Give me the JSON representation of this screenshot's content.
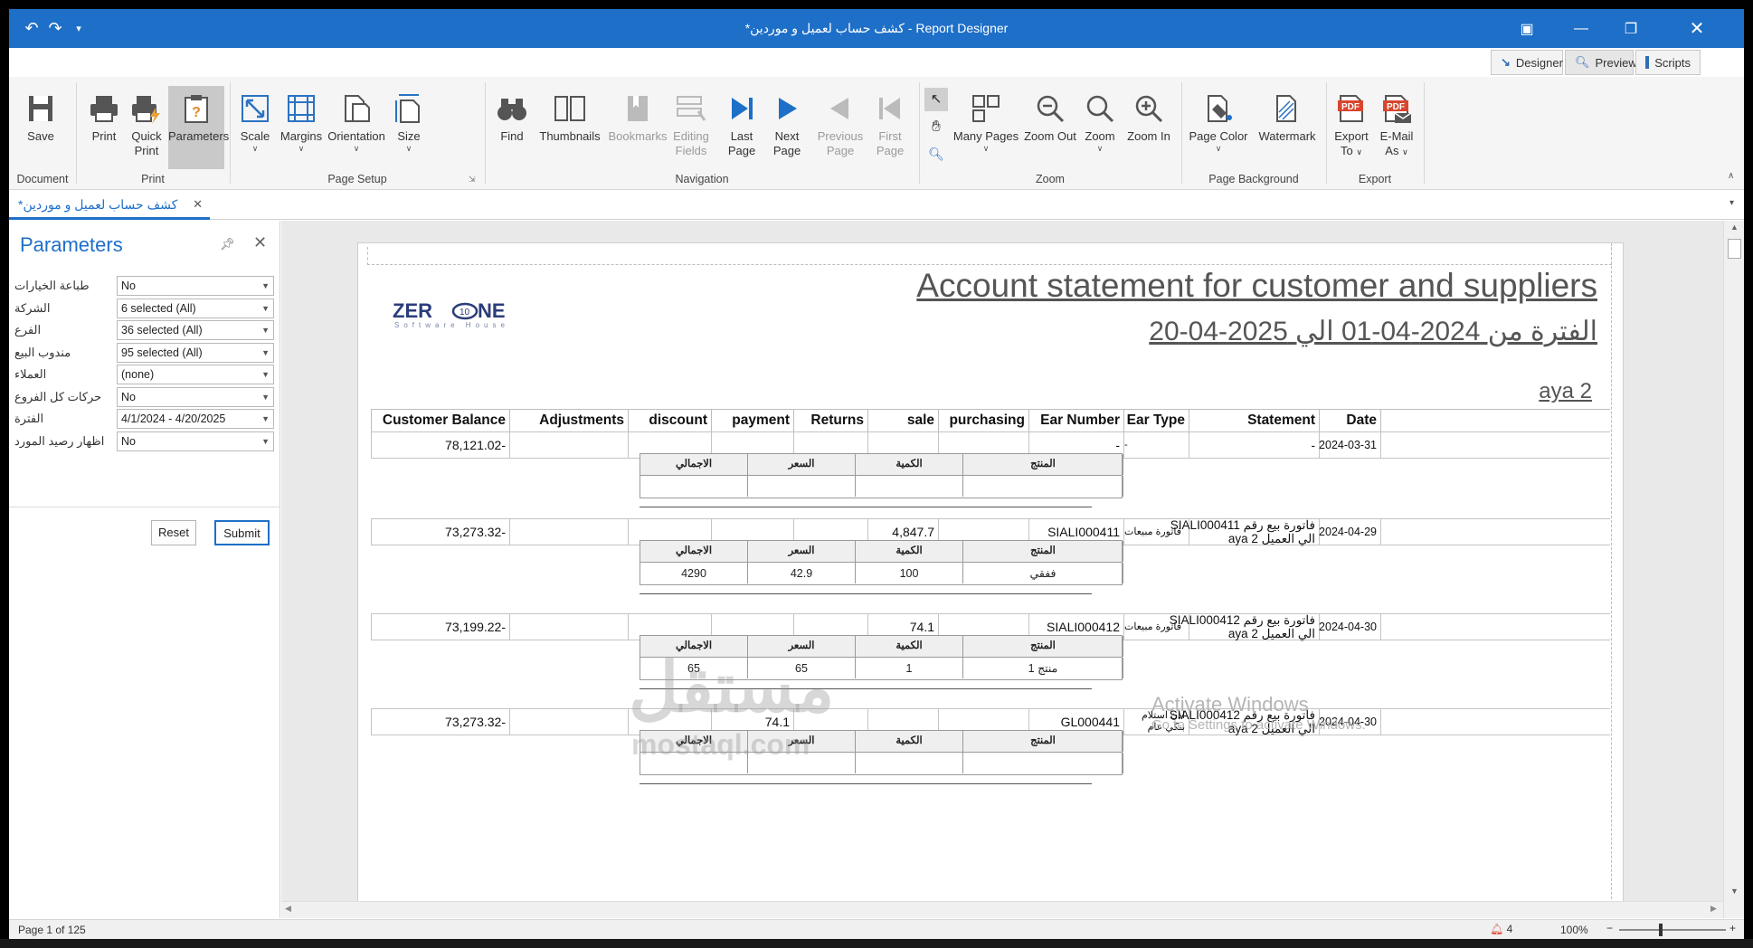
{
  "window": {
    "title": "*كشف حساب لعميل و موردين - Report Designer"
  },
  "views": {
    "designer": "Designer",
    "preview": "Preview",
    "scripts": "Scripts"
  },
  "ribbon": {
    "save": "Save",
    "print": "Print",
    "quick_print_1": "Quick",
    "quick_print_2": "Print",
    "parameters": "Parameters",
    "scale": "Scale",
    "margins": "Margins",
    "orientation": "Orientation",
    "size": "Size",
    "find": "Find",
    "thumbnails": "Thumbnails",
    "bookmarks": "Bookmarks",
    "editing_fields_1": "Editing",
    "editing_fields_2": "Fields",
    "last_page_1": "Last",
    "last_page_2": "Page",
    "next_page_1": "Next",
    "next_page_2": "Page",
    "previous_page_1": "Previous",
    "previous_page_2": "Page",
    "first_page_1": "First",
    "first_page_2": "Page",
    "many_pages": "Many Pages",
    "zoom_out": "Zoom Out",
    "zoom": "Zoom",
    "zoom_in": "Zoom In",
    "page_color": "Page Color",
    "watermark": "Watermark",
    "export_to_1": "Export",
    "export_to_2": "To",
    "email_as_1": "E-Mail",
    "email_as_2": "As",
    "pdf_badge": "PDF",
    "groups": {
      "document": "Document",
      "print": "Print",
      "page_setup": "Page Setup",
      "navigation": "Navigation",
      "zoom": "Zoom",
      "page_background": "Page Background",
      "export": "Export"
    }
  },
  "doc_tab": {
    "label": "*كشف حساب لعميل و موردين"
  },
  "parameters": {
    "title": "Parameters",
    "rows": [
      {
        "label": "طباعة الخيارات",
        "value": "No"
      },
      {
        "label": "الشركة",
        "value": "6 selected (All)"
      },
      {
        "label": "الفرع",
        "value": "36 selected (All)"
      },
      {
        "label": "مندوب البيع",
        "value": "95 selected (All)"
      },
      {
        "label": "العملاء",
        "value": "(none)"
      },
      {
        "label": "حركات كل الفروع",
        "value": "No"
      },
      {
        "label": "الفترة",
        "value": "4/1/2024 - 4/20/2025"
      },
      {
        "label": "اظهار رصيد المورد",
        "value": "No"
      }
    ],
    "reset": "Reset",
    "submit": "Submit"
  },
  "report": {
    "title": "Account statement for customer and suppliers",
    "period": "الفترة من 2024-04-01 الي 2025-04-20",
    "customer": "aya 2",
    "logo_text": "ZER",
    "logo_text2": "NE",
    "logo_sub": "Software House",
    "columns": [
      "Customer Balance",
      "Adjustments",
      "discount",
      "payment",
      "Returns",
      "sale",
      "purchasing",
      "Ear Number",
      "Ear Type",
      "Statement",
      "Date"
    ],
    "sub_columns": [
      "الاجمالي",
      "السعر",
      "الكمية",
      "المنتج"
    ],
    "rows": [
      {
        "balance": "78,121.02-",
        "adjustments": "",
        "discount": "",
        "payment": "",
        "returns": "",
        "sale": "",
        "purchasing": "",
        "ear_number": "-",
        "ear_type": "-",
        "statement_1": "-",
        "statement_2": "",
        "date": "2024-03-31",
        "sub": {
          "total": "",
          "price": "",
          "qty": "",
          "product": ""
        }
      },
      {
        "balance": "73,273.32-",
        "adjustments": "",
        "discount": "",
        "payment": "",
        "returns": "",
        "sale": "4,847.7",
        "purchasing": "",
        "ear_number": "SIALI000411",
        "ear_type": "فاتورة مبيعات",
        "statement_1": "فاتورة بيع رقم SIALI000411",
        "statement_2": "الي العميل  aya 2",
        "date": "2024-04-29",
        "sub": {
          "total": "4290",
          "price": "42.9",
          "qty": "100",
          "product": "ففقي"
        }
      },
      {
        "balance": "73,199.22-",
        "adjustments": "",
        "discount": "",
        "payment": "",
        "returns": "",
        "sale": "74.1",
        "purchasing": "",
        "ear_number": "SIALI000412",
        "ear_type": "فاتورة مبيعات",
        "statement_1": "فاتورة بيع رقم SIALI000412",
        "statement_2": "الي العميل  aya 2",
        "date": "2024-04-30",
        "sub": {
          "total": "65",
          "price": "65",
          "qty": "1",
          "product": "منتج 1"
        }
      },
      {
        "balance": "73,273.32-",
        "adjustments": "",
        "discount": "",
        "payment": "74.1",
        "returns": "",
        "sale": "",
        "purchasing": "",
        "ear_number": "GL000441",
        "ear_type": "اذن استلام بنكي عام",
        "statement_1": "فاتورة بيع رقم SIALI000412",
        "statement_2": "الي العميل  aya 2",
        "date": "2024-04-30",
        "sub": {
          "total": "",
          "price": "",
          "qty": "",
          "product": ""
        }
      }
    ]
  },
  "overlay": {
    "activate_1": "Activate Windows",
    "activate_2": "Go to Settings to activate Windows.",
    "mostaql_ar": "مستقل",
    "mostaql_en": "mostaql.com"
  },
  "status": {
    "page": "Page 1 of 125",
    "notifications": "4",
    "zoom": "100%"
  }
}
